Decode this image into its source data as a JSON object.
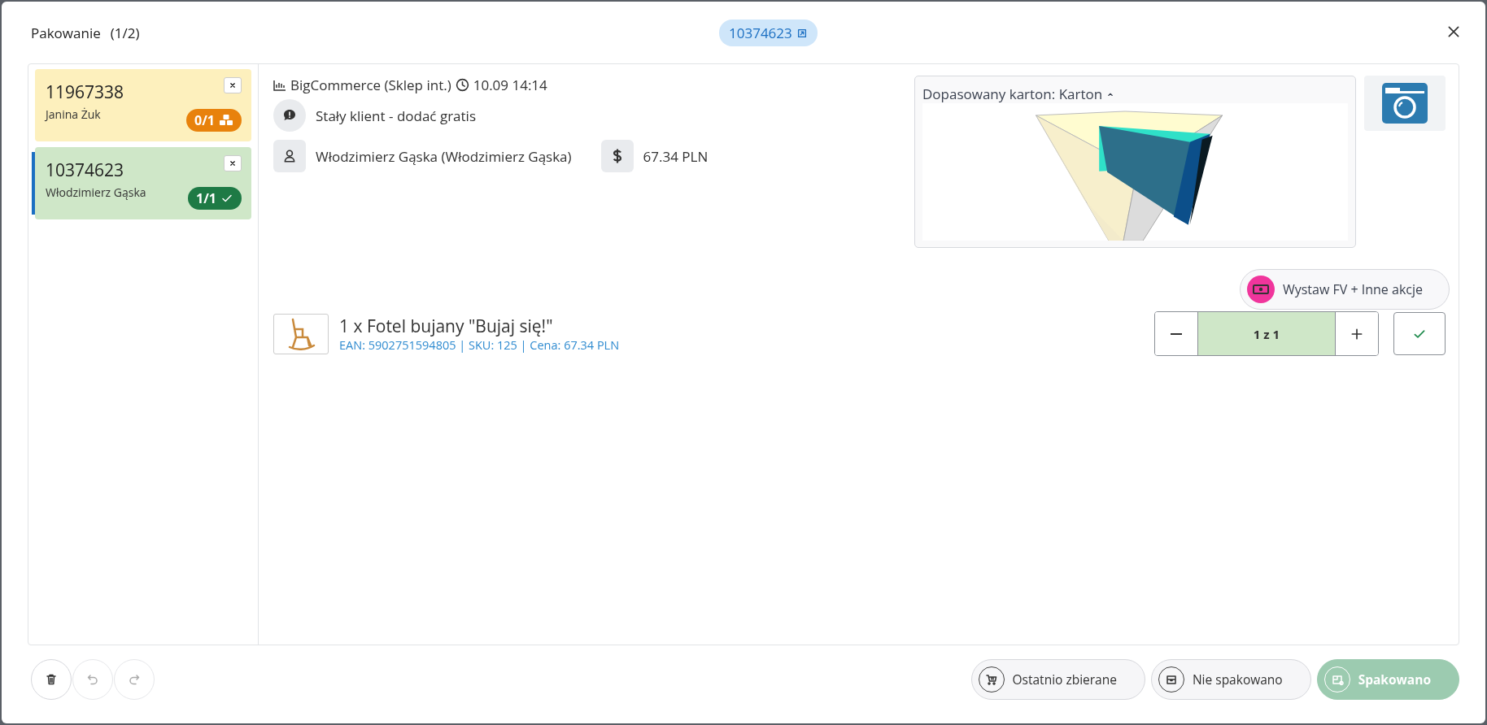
{
  "window": {
    "title": "Pakowanie",
    "counter": "(1/2)",
    "order_chip": "10374623"
  },
  "orders": [
    {
      "number": "11967338",
      "customer": "Janina Żuk",
      "badge": "0/1",
      "complete": false,
      "selected": false
    },
    {
      "number": "10374623",
      "customer": "Włodzimierz Gąska",
      "badge": "1/1",
      "complete": true,
      "selected": true
    }
  ],
  "order_info": {
    "source": "BigCommerce (Sklep int.)",
    "date": "10.09 14:14",
    "note": "Stały klient - dodać gratis",
    "customer": "Włodzimierz Gąska (Włodzimierz Gąska)",
    "total": "67.34 PLN"
  },
  "carton": {
    "label": "Dopasowany karton: Karton",
    "expanded": true
  },
  "actions_button": "Wystaw FV + Inne akcje",
  "items": [
    {
      "title": "1 x Fotel bujany \"Bujaj się!\"",
      "details": "EAN: 5902751594805 | SKU: 125 | Cena: 67.34 PLN",
      "counter": "1 z 1",
      "complete": true
    }
  ],
  "footer": {
    "tools": [
      {
        "kind": "delete",
        "disabled": false
      },
      {
        "kind": "undo",
        "disabled": true
      },
      {
        "kind": "redo",
        "disabled": true
      }
    ],
    "buttons": [
      {
        "label": "Ostatnio zbierane",
        "kind": "recent",
        "primary": false
      },
      {
        "label": "Nie spakowano",
        "kind": "unpacked",
        "primary": false
      },
      {
        "label": "Spakowano",
        "kind": "packed",
        "primary": true
      }
    ]
  }
}
